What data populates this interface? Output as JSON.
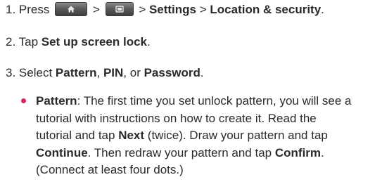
{
  "steps": [
    {
      "number": "1.",
      "parts": {
        "press": "Press",
        "sep1": ">",
        "sep2": ">",
        "settings": "Settings",
        "sep3": ">",
        "location": "Location & security",
        "end": "."
      },
      "icons": [
        "home-key-icon",
        "menu-key-icon"
      ]
    },
    {
      "number": "2.",
      "parts": {
        "tap": "Tap",
        "item": "Set up screen lock",
        "end": "."
      }
    },
    {
      "number": "3.",
      "parts": {
        "select": "Select",
        "pattern": "Pattern",
        "comma1": ",",
        "pin": "PIN",
        "or": ", or",
        "password": "Password",
        "end": "."
      }
    }
  ],
  "bullet": {
    "line1": {
      "term": "Pattern",
      "rest": ": The first time you set unlock pattern, you will see a"
    },
    "line2": "tutorial with instructions on how to create it. Read the",
    "line3": {
      "pre": "tutorial and tap",
      "next": "Next",
      "post": "(twice). Draw your pattern and tap"
    },
    "line4": {
      "cont": "Continue",
      "mid": ". Then redraw your pattern and tap",
      "confirm": "Confirm",
      "end": "."
    },
    "line5": "(Connect at least four dots.)"
  },
  "colors": {
    "bullet": "#d6256b",
    "text": "#2a2a2a",
    "key": "#5a5a5a"
  }
}
